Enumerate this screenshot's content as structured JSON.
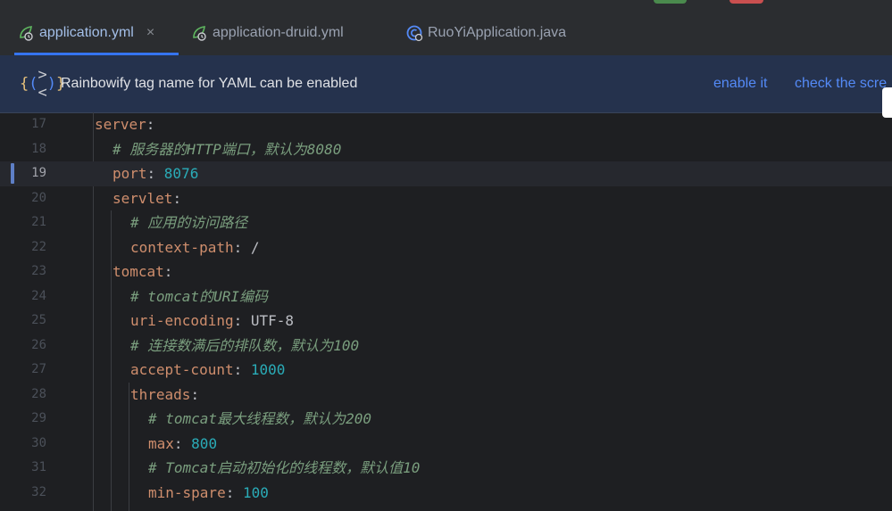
{
  "tabs": [
    {
      "label": "application.yml",
      "icon": "yaml-file-icon",
      "active": true,
      "close": "×"
    },
    {
      "label": "application-druid.yml",
      "icon": "yaml-file-icon",
      "active": false
    },
    {
      "label": "RuoYiApplication.java",
      "icon": "java-class-icon",
      "active": false
    }
  ],
  "banner": {
    "icon_text": "{(><)}",
    "message": "Rainbowify tag name for YAML can be enabled",
    "enable_label": "enable it",
    "check_label": "check the scre"
  },
  "colors": {
    "accent": "#3574f0",
    "keyword": "#cf8e6d",
    "comment": "#7a9e7e",
    "number": "#2aacb8",
    "banner_link": "#548af7"
  },
  "editor": {
    "current_line": "19",
    "lines": [
      {
        "n": "17",
        "key": "server",
        "colon": ":",
        "value": ""
      },
      {
        "n": "18",
        "comment": "# 服务器的HTTP端口，默认为8080"
      },
      {
        "n": "19",
        "key": "port",
        "colon": ": ",
        "value": "8076",
        "vtype": "num"
      },
      {
        "n": "20",
        "key": "servlet",
        "colon": ":",
        "value": ""
      },
      {
        "n": "21",
        "comment": "# 应用的访问路径"
      },
      {
        "n": "22",
        "key": "context-path",
        "colon": ": ",
        "value": "/",
        "vtype": "plain"
      },
      {
        "n": "23",
        "key": "tomcat",
        "colon": ":",
        "value": ""
      },
      {
        "n": "24",
        "comment": "# tomcat的URI编码"
      },
      {
        "n": "25",
        "key": "uri-encoding",
        "colon": ": ",
        "value": "UTF-8",
        "vtype": "plain"
      },
      {
        "n": "26",
        "comment": "# 连接数满后的排队数，默认为100"
      },
      {
        "n": "27",
        "key": "accept-count",
        "colon": ": ",
        "value": "1000",
        "vtype": "num"
      },
      {
        "n": "28",
        "key": "threads",
        "colon": ":",
        "value": ""
      },
      {
        "n": "29",
        "comment": "# tomcat最大线程数，默认为200"
      },
      {
        "n": "30",
        "key": "max",
        "colon": ": ",
        "value": "800",
        "vtype": "num"
      },
      {
        "n": "31",
        "comment": "# Tomcat启动初始化的线程数，默认值10"
      },
      {
        "n": "32",
        "key": "min-spare",
        "colon": ": ",
        "value": "100",
        "vtype": "num"
      }
    ]
  }
}
